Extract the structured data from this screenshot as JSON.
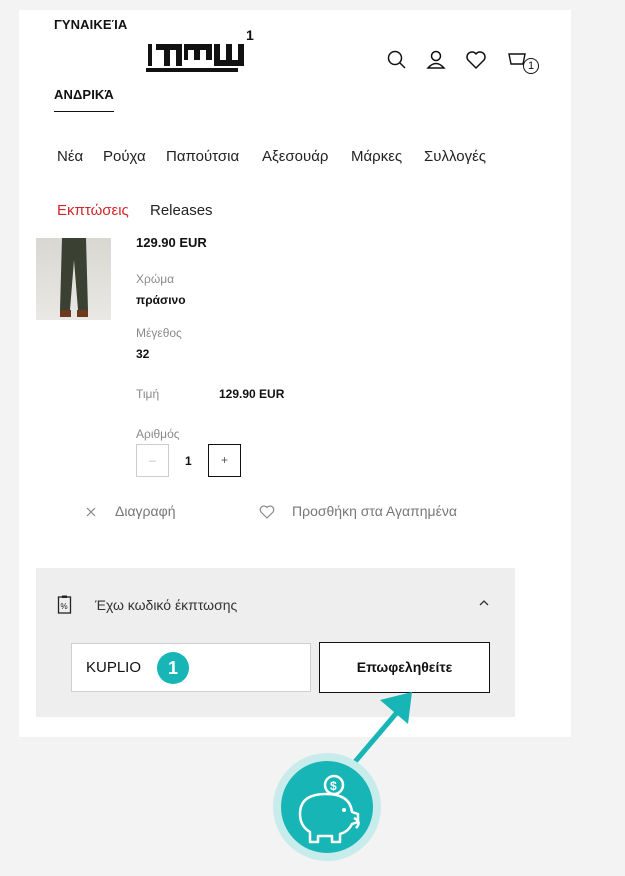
{
  "header": {
    "gender_women": "ΓΥΝΑΙΚΕΊΑ",
    "gender_men": "ΑΝΔΡΙΚΆ",
    "cart_count": "1"
  },
  "nav": {
    "items": [
      "Νέα",
      "Ρούχα",
      "Παπούτσια",
      "Αξεσουάρ",
      "Μάρκες",
      "Συλλογές"
    ],
    "sale": "Εκπτώσεις",
    "releases": "Releases"
  },
  "product": {
    "top_price": "129.90 EUR",
    "color_label": "Χρώμα",
    "color_value": "πράσινο",
    "size_label": "Μέγεθος",
    "size_value": "32",
    "price_label": "Τιμή",
    "price_value": "129.90 EUR",
    "qty_label": "Αριθμός",
    "qty_value": "1",
    "qty_minus": "–",
    "qty_plus": "+"
  },
  "actions": {
    "delete": "Διαγραφή",
    "add_favorites": "Προσθήκη στα Αγαπημένα"
  },
  "coupon": {
    "header": "Έχω κωδικό έκπτωσης",
    "code_value": "KUPLIO",
    "apply_label": "Επωφεληθείτε",
    "step_number": "1"
  },
  "colors": {
    "accent_teal": "#17b5b5",
    "sale_red": "#d0262b"
  }
}
